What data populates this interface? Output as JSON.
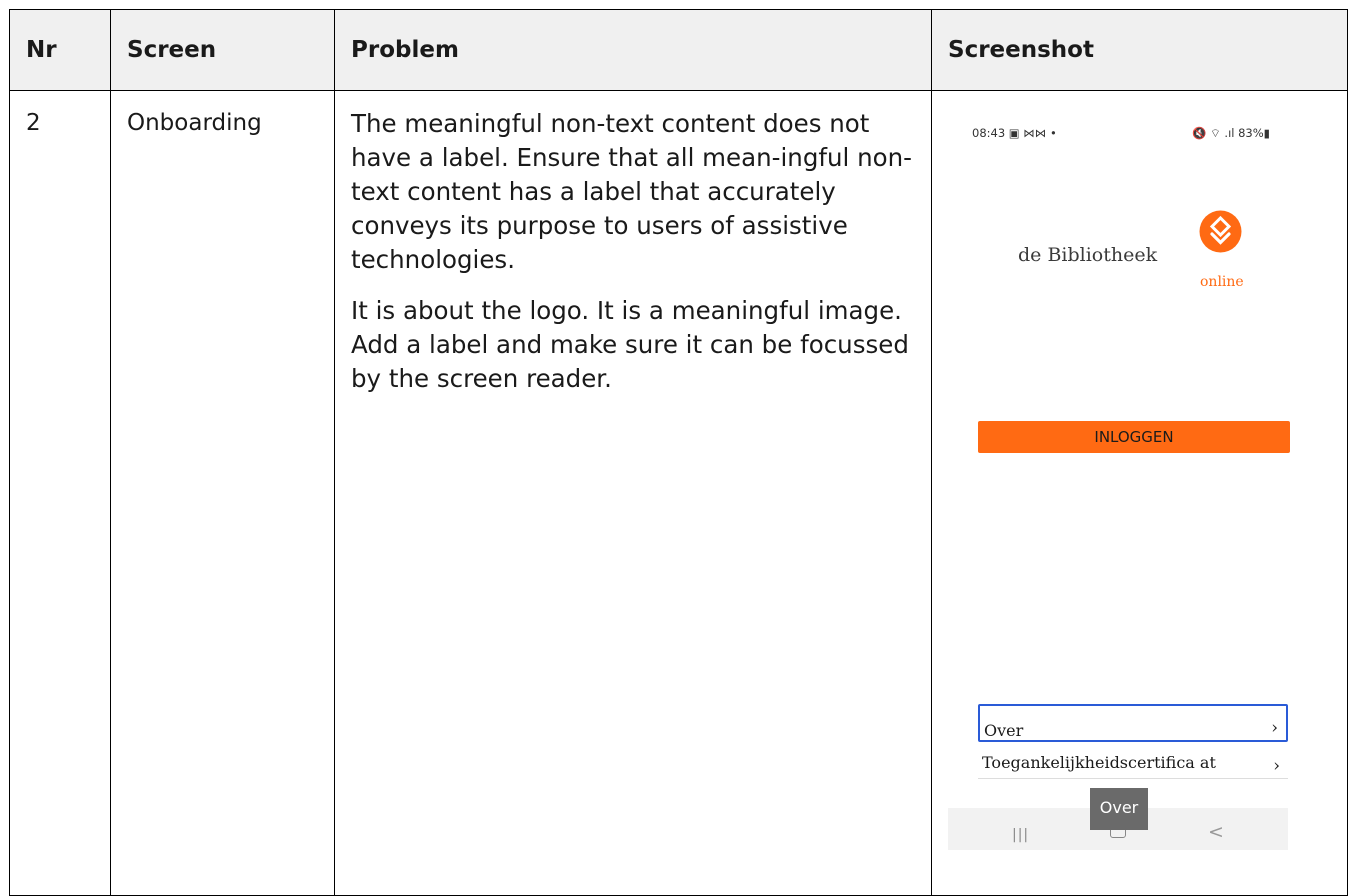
{
  "table": {
    "headers": [
      "Nr",
      "Screen",
      "Problem",
      "Screenshot"
    ],
    "row": {
      "nr": "2",
      "screen": "Onboarding",
      "problem_paragraphs": [
        "The meaningful non-text content does not have a label. Ensure that all mean-ingful non-text content has a label that accurately conveys its purpose to users of assistive technologies.",
        "It is about the logo. It is a meaningful image. Add a label and make sure it can be focussed by the screen reader."
      ]
    }
  },
  "screenshot": {
    "status_bar": {
      "time_icons": "08:43 ▣ ⋈⋈ •",
      "right": "🔇 ⌔ .ıl 83%▮"
    },
    "logo": {
      "text": "de Bibliotheek",
      "sub": "online",
      "accent_color": "#ff6a13"
    },
    "login_button": "INLOGGEN",
    "menu": [
      {
        "label": "Over",
        "chevron": "›"
      },
      {
        "label": "Toegankelijkheidscertifica at",
        "chevron": "›"
      }
    ],
    "navbar": {
      "recent_icon": "|||",
      "back_icon": "<"
    },
    "tooltip": "Over",
    "focus_color": "#2a5bd7"
  }
}
